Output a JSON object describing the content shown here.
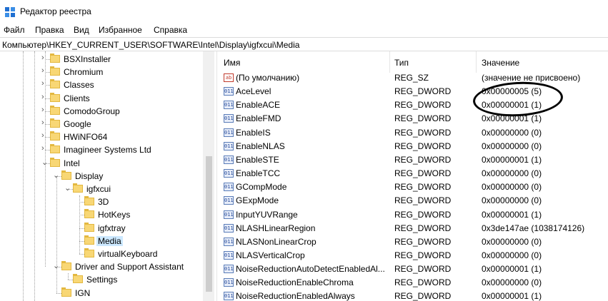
{
  "window": {
    "title": "Редактор реестра"
  },
  "menu": [
    "Файл",
    "Правка",
    "Вид",
    "Избранное",
    "Справка"
  ],
  "address": "Компьютер\\HKEY_CURRENT_USER\\SOFTWARE\\Intel\\Display\\igfxcui\\Media",
  "tree": [
    {
      "label": "BSXInstaller",
      "level": 0,
      "chevron": "›"
    },
    {
      "label": "Chromium",
      "level": 0,
      "chevron": "›"
    },
    {
      "label": "Classes",
      "level": 0,
      "chevron": "›"
    },
    {
      "label": "Clients",
      "level": 0,
      "chevron": "›"
    },
    {
      "label": "ComodoGroup",
      "level": 0,
      "chevron": "›"
    },
    {
      "label": "Google",
      "level": 0,
      "chevron": "›"
    },
    {
      "label": "HWiNFO64",
      "level": 0,
      "chevron": "›"
    },
    {
      "label": "Imagineer Systems Ltd",
      "level": 0,
      "chevron": "›"
    },
    {
      "label": "Intel",
      "level": 0,
      "chevron": "⌄"
    },
    {
      "label": "Display",
      "level": 1,
      "chevron": "⌄"
    },
    {
      "label": "igfxcui",
      "level": 2,
      "chevron": "⌄"
    },
    {
      "label": "3D",
      "level": 3,
      "chevron": ""
    },
    {
      "label": "HotKeys",
      "level": 3,
      "chevron": ""
    },
    {
      "label": "igfxtray",
      "level": 3,
      "chevron": ""
    },
    {
      "label": "Media",
      "level": 3,
      "chevron": "",
      "selected": true
    },
    {
      "label": "virtualKeyboard",
      "level": 3,
      "chevron": ""
    },
    {
      "label": "Driver and Support Assistant",
      "level": 1,
      "chevron": "⌄"
    },
    {
      "label": "Settings",
      "level": 2,
      "chevron": ""
    },
    {
      "label": "IGN",
      "level": 1,
      "chevron": ""
    }
  ],
  "columns": {
    "name": "Имя",
    "type": "Тип",
    "value": "Значение"
  },
  "values": [
    {
      "icon": "ab",
      "name": "(По умолчанию)",
      "type": "REG_SZ",
      "data": "(значение не присвоено)"
    },
    {
      "icon": "011",
      "name": "AceLevel",
      "type": "REG_DWORD",
      "data": "0x00000005 (5)"
    },
    {
      "icon": "011",
      "name": "EnableACE",
      "type": "REG_DWORD",
      "data": "0x00000001 (1)"
    },
    {
      "icon": "011",
      "name": "EnableFMD",
      "type": "REG_DWORD",
      "data": "0x00000001 (1)"
    },
    {
      "icon": "011",
      "name": "EnableIS",
      "type": "REG_DWORD",
      "data": "0x00000000 (0)"
    },
    {
      "icon": "011",
      "name": "EnableNLAS",
      "type": "REG_DWORD",
      "data": "0x00000000 (0)"
    },
    {
      "icon": "011",
      "name": "EnableSTE",
      "type": "REG_DWORD",
      "data": "0x00000001 (1)"
    },
    {
      "icon": "011",
      "name": "EnableTCC",
      "type": "REG_DWORD",
      "data": "0x00000000 (0)"
    },
    {
      "icon": "011",
      "name": "GCompMode",
      "type": "REG_DWORD",
      "data": "0x00000000 (0)"
    },
    {
      "icon": "011",
      "name": "GExpMode",
      "type": "REG_DWORD",
      "data": "0x00000000 (0)"
    },
    {
      "icon": "011",
      "name": "InputYUVRange",
      "type": "REG_DWORD",
      "data": "0x00000001 (1)"
    },
    {
      "icon": "011",
      "name": "NLASHLinearRegion",
      "type": "REG_DWORD",
      "data": "0x3de147ae (1038174126)"
    },
    {
      "icon": "011",
      "name": "NLASNonLinearCrop",
      "type": "REG_DWORD",
      "data": "0x00000000 (0)"
    },
    {
      "icon": "011",
      "name": "NLASVerticalCrop",
      "type": "REG_DWORD",
      "data": "0x00000000 (0)"
    },
    {
      "icon": "011",
      "name": "NoiseReductionAutoDetectEnabledAl...",
      "type": "REG_DWORD",
      "data": "0x00000001 (1)"
    },
    {
      "icon": "011",
      "name": "NoiseReductionEnableChroma",
      "type": "REG_DWORD",
      "data": "0x00000000 (0)"
    },
    {
      "icon": "011",
      "name": "NoiseReductionEnabledAlways",
      "type": "REG_DWORD",
      "data": "0x00000001 (1)"
    }
  ]
}
